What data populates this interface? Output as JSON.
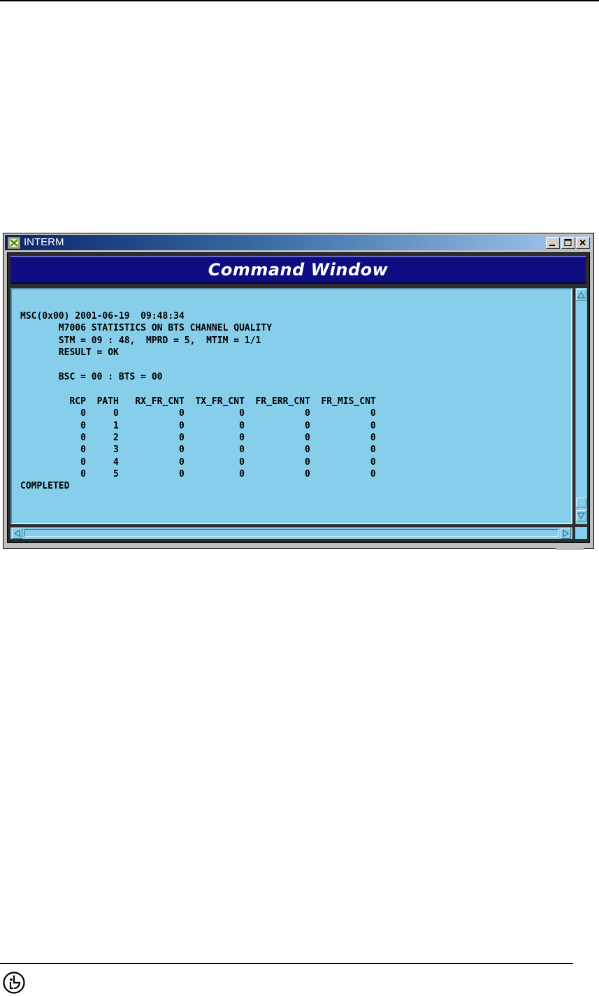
{
  "window": {
    "title": "INTERM",
    "header_title": "Command Window"
  },
  "terminal": {
    "lines": [
      "MSC(0x00) 2001-06-19  09:48:34",
      "       M7006 STATISTICS ON BTS CHANNEL QUALITY",
      "       STM = 09 : 48,  MPRD = 5,  MTIM = 1/1",
      "       RESULT = OK",
      "",
      "       BSC = 00 : BTS = 00",
      "",
      "         RCP  PATH   RX_FR_CNT  TX_FR_CNT  FR_ERR_CNT  FR_MIS_CNT",
      "           0     0           0          0           0           0",
      "           0     1           0          0           0           0",
      "           0     2           0          0           0           0",
      "           0     3           0          0           0           0",
      "           0     4           0          0           0           0",
      "           0     5           0          0           0           0",
      "COMPLETED"
    ]
  },
  "icons": {
    "app": "interm-app-icon",
    "minimize": "minimize-icon",
    "maximize": "maximize-icon",
    "close": "close-icon",
    "scroll_up": "arrow-up-icon",
    "scroll_down": "arrow-down-icon",
    "scroll_left": "arrow-left-icon",
    "scroll_right": "arrow-right-icon",
    "logo": "lg-logo-icon"
  },
  "colors": {
    "terminal_bg": "#87ceeb",
    "header_bg": "#0e0e82",
    "titlebar_start": "#0a246a"
  }
}
